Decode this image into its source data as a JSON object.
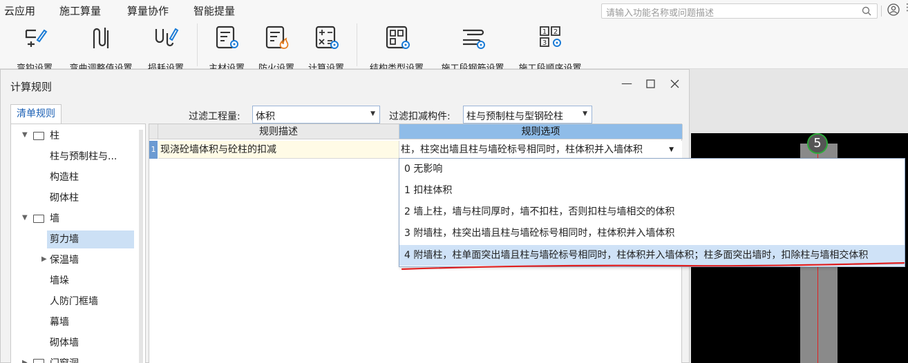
{
  "menu": {
    "items": [
      "云应用",
      "施工算量",
      "算量协作",
      "智能提量"
    ],
    "search_placeholder": "请输入功能名称或问题描述"
  },
  "ribbon": {
    "buttons": [
      "置",
      "弯钩设置",
      "弯曲调整值设置",
      "损耗设置",
      "主材设置",
      "防火设置",
      "计算设置",
      "结构类型设置",
      "施工段钢筋设置",
      "施工段顺序设置"
    ]
  },
  "dialog": {
    "title": "计算规则",
    "tab_label": "清单规则",
    "filter_quantity_label": "过滤工程量:",
    "filter_quantity_value": "体积",
    "filter_deduct_label": "过滤扣减构件:",
    "filter_deduct_value": "柱与预制柱与型钢砼柱"
  },
  "tree": {
    "nodes": [
      {
        "label": "柱",
        "kind": "folder"
      },
      {
        "label": "柱与预制柱与...",
        "kind": "leaf"
      },
      {
        "label": "构造柱",
        "kind": "leaf"
      },
      {
        "label": "砌体柱",
        "kind": "leaf"
      },
      {
        "label": "墙",
        "kind": "folder"
      },
      {
        "label": "剪力墙",
        "kind": "leaf",
        "selected": true
      },
      {
        "label": "保温墙",
        "kind": "collapsed"
      },
      {
        "label": "墙垛",
        "kind": "leaf"
      },
      {
        "label": "人防门框墙",
        "kind": "leaf"
      },
      {
        "label": "幕墙",
        "kind": "leaf"
      },
      {
        "label": "砌体墙",
        "kind": "leaf"
      },
      {
        "label": "门窗洞",
        "kind": "folder-collapsed"
      }
    ]
  },
  "grid": {
    "col_desc": "规则描述",
    "col_option": "规则选项",
    "row_number": "1",
    "row_desc": "现浇砼墙体积与砼柱的扣减",
    "row_option": "柱，柱突出墙且柱与墙砼标号相同时，柱体积并入墙体积"
  },
  "dropdown": {
    "options": [
      "0  无影响",
      "1  扣柱体积",
      "2  墙上柱，墙与柱同厚时，墙不扣柱，否则扣柱与墙相交的体积",
      "3  附墙柱，柱突出墙且柱与墙砼标号相同时，柱体积并入墙体积",
      "4  附墙柱，柱单面突出墙且柱与墙砼标号相同时，柱体积并入墙体积；柱多面突出墙时，扣除柱与墙相交体积"
    ],
    "selected_index": 4
  },
  "canvas": {
    "axis_label": "5"
  },
  "colors": {
    "accent": "#1a5fb4",
    "selection": "#cfe2f7",
    "annotation": "#e02020"
  }
}
